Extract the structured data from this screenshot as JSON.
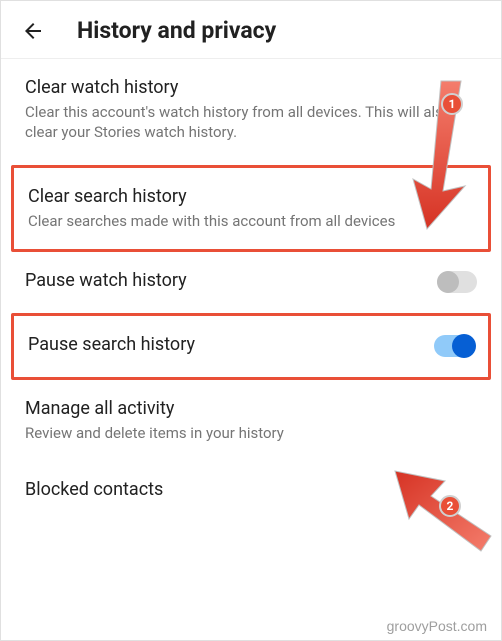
{
  "header": {
    "title": "History and privacy"
  },
  "items": {
    "clear_watch": {
      "title": "Clear watch history",
      "subtitle": "Clear this account's watch history from all devices. This will also clear your Stories watch history."
    },
    "clear_search": {
      "title": "Clear search history",
      "subtitle": "Clear searches made with this account from all devices"
    },
    "pause_watch": {
      "title": "Pause watch history"
    },
    "pause_search": {
      "title": "Pause search history"
    },
    "manage_activity": {
      "title": "Manage all activity",
      "subtitle": "Review and delete items in your history"
    },
    "blocked_contacts": {
      "title": "Blocked contacts"
    }
  },
  "annotations": {
    "badge1": "1",
    "badge2": "2"
  },
  "watermark": "groovyPost.com"
}
